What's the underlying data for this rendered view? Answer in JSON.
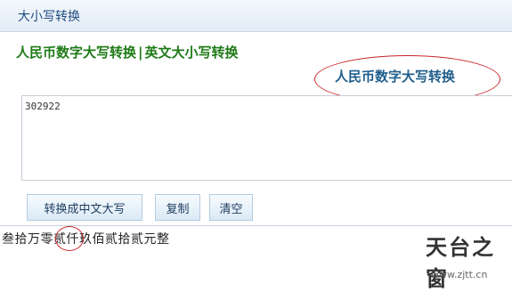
{
  "titlebar": {
    "title": "大小写转换"
  },
  "nav": {
    "item1": "人民币数字大写转换",
    "separator": "|",
    "item2": "英文大小写转换"
  },
  "section_heading": "人民币数字大写转换",
  "input": {
    "value": "302922"
  },
  "buttons": {
    "convert": "转换成中文大写",
    "copy": "复制",
    "clear": "清空"
  },
  "result": {
    "value": "叁拾万零贰仟玖佰贰拾贰元整"
  },
  "watermark": {
    "logo": "天台之窗",
    "url": "www.zjtt.cn"
  },
  "colors": {
    "nav_green": "#1e7a16",
    "heading_blue": "#1f5e8c",
    "annotation_red": "#c9262a"
  }
}
